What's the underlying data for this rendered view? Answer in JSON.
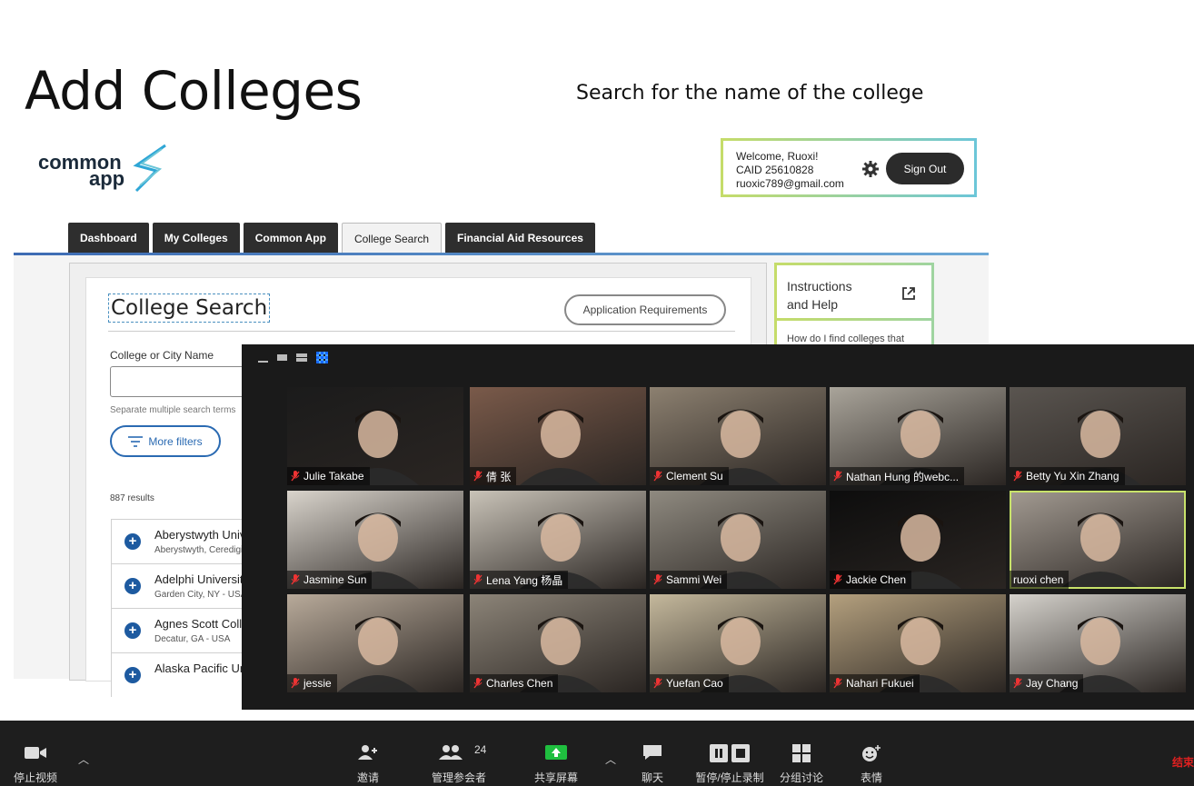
{
  "slide": {
    "title": "Add Colleges",
    "subtitle": "Search for the name of the college"
  },
  "logo": {
    "word1": "common",
    "word2": "app"
  },
  "welcome": {
    "greeting": "Welcome, Ruoxi!",
    "caid": "CAID 25610828",
    "email": "ruoxic789@gmail.com",
    "sign_out": "Sign Out"
  },
  "tabs": [
    {
      "label": "Dashboard"
    },
    {
      "label": "My Colleges"
    },
    {
      "label": "Common App"
    },
    {
      "label": "College Search"
    },
    {
      "label": "Financial Aid Resources"
    }
  ],
  "college_search": {
    "title": "College Search",
    "app_requirements": "Application Requirements",
    "city_label": "College or City Name",
    "hint": "Separate multiple search terms",
    "more_filters": "More filters",
    "results": "887 results",
    "colleges": [
      {
        "name": "Aberystwyth University",
        "location": "Aberystwyth, Ceredigion"
      },
      {
        "name": "Adelphi University",
        "location": "Garden City, NY - USA"
      },
      {
        "name": "Agnes Scott College",
        "location": "Decatur, GA - USA"
      },
      {
        "name": "Alaska Pacific University",
        "location": ""
      }
    ]
  },
  "instructions": {
    "title_line1": "Instructions",
    "title_line2": "and Help",
    "faq": "How do I find colleges that"
  },
  "participants": [
    {
      "name": "Julie Takabe",
      "bg": "#1b1b1b"
    },
    {
      "name": "倩 张",
      "bg": "#7a5a4a"
    },
    {
      "name": "Clement Su",
      "bg": "#8c8070"
    },
    {
      "name": "Nathan Hung 的webc...",
      "bg": "#a9a49a"
    },
    {
      "name": "Betty Yu Xin Zhang",
      "bg": "#5a5550"
    },
    {
      "name": "Jasmine Sun",
      "bg": "#d9d4cc"
    },
    {
      "name": "Lena Yang 杨晶",
      "bg": "#c9c3b8"
    },
    {
      "name": "Sammi Wei",
      "bg": "#8f8a80"
    },
    {
      "name": "Jackie Chen",
      "bg": "#0d0d0d"
    },
    {
      "name": "ruoxi chen",
      "bg": "#a39b92"
    },
    {
      "name": "jessie",
      "bg": "#b8aa9a"
    },
    {
      "name": "Charles Chen",
      "bg": "#8c8478"
    },
    {
      "name": "Yuefan Cao",
      "bg": "#c4b89c"
    },
    {
      "name": "Nahari Fukuei",
      "bg": "#b4a07e"
    },
    {
      "name": "Jay Chang",
      "bg": "#d5d2cc"
    }
  ],
  "toolbar": {
    "stop_video": "停止视频",
    "invite": "邀请",
    "manage_participants": "管理参会者",
    "participant_count": "24",
    "share_screen": "共享屏幕",
    "chat": "聊天",
    "pause_record": "暂停/停止录制",
    "breakout": "分组讨论",
    "reactions": "表情",
    "end": "结束"
  },
  "colors": {
    "share_green": "#1fbf3f",
    "end_red": "#e02020",
    "active_speaker": "#c8e26a",
    "link_blue": "#2a6ab2"
  }
}
